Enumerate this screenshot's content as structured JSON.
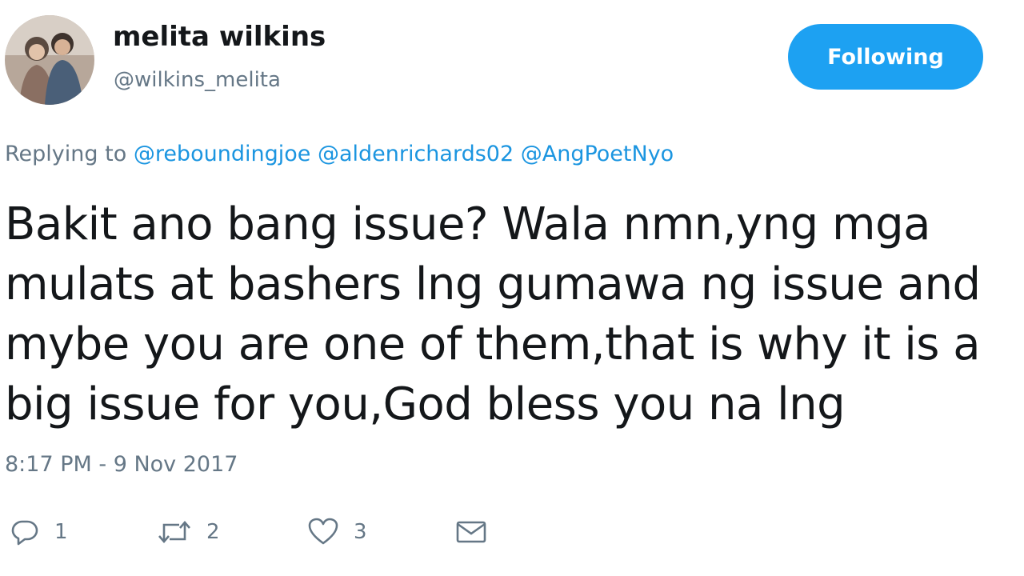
{
  "user": {
    "display_name": "melita wilkins",
    "handle": "@wilkins_melita"
  },
  "follow_button": {
    "label": "Following",
    "color": "#1da1f2"
  },
  "reply": {
    "prefix": "Replying to ",
    "mentions": [
      "@reboundingjoe",
      "@aldenrichards02",
      "@AngPoetNyo"
    ]
  },
  "tweet": {
    "lines": [
      "Bakit ano bang issue? Wala nmn,yng mga",
      "mulats at bashers lng gumawa ng issue and",
      "mybe you are one of them,that is why it is a",
      "big issue for you,God bless you na lng"
    ],
    "timestamp": "8:17 PM - 9 Nov 2017"
  },
  "actions": {
    "reply": {
      "icon": "reply-icon",
      "count": "1"
    },
    "retweet": {
      "icon": "retweet-icon",
      "count": "2"
    },
    "like": {
      "icon": "heart-icon",
      "count": "3"
    },
    "dm": {
      "icon": "envelope-icon"
    }
  },
  "colors": {
    "text": "#14171a",
    "secondary": "#657786",
    "link": "#1b95e0"
  }
}
